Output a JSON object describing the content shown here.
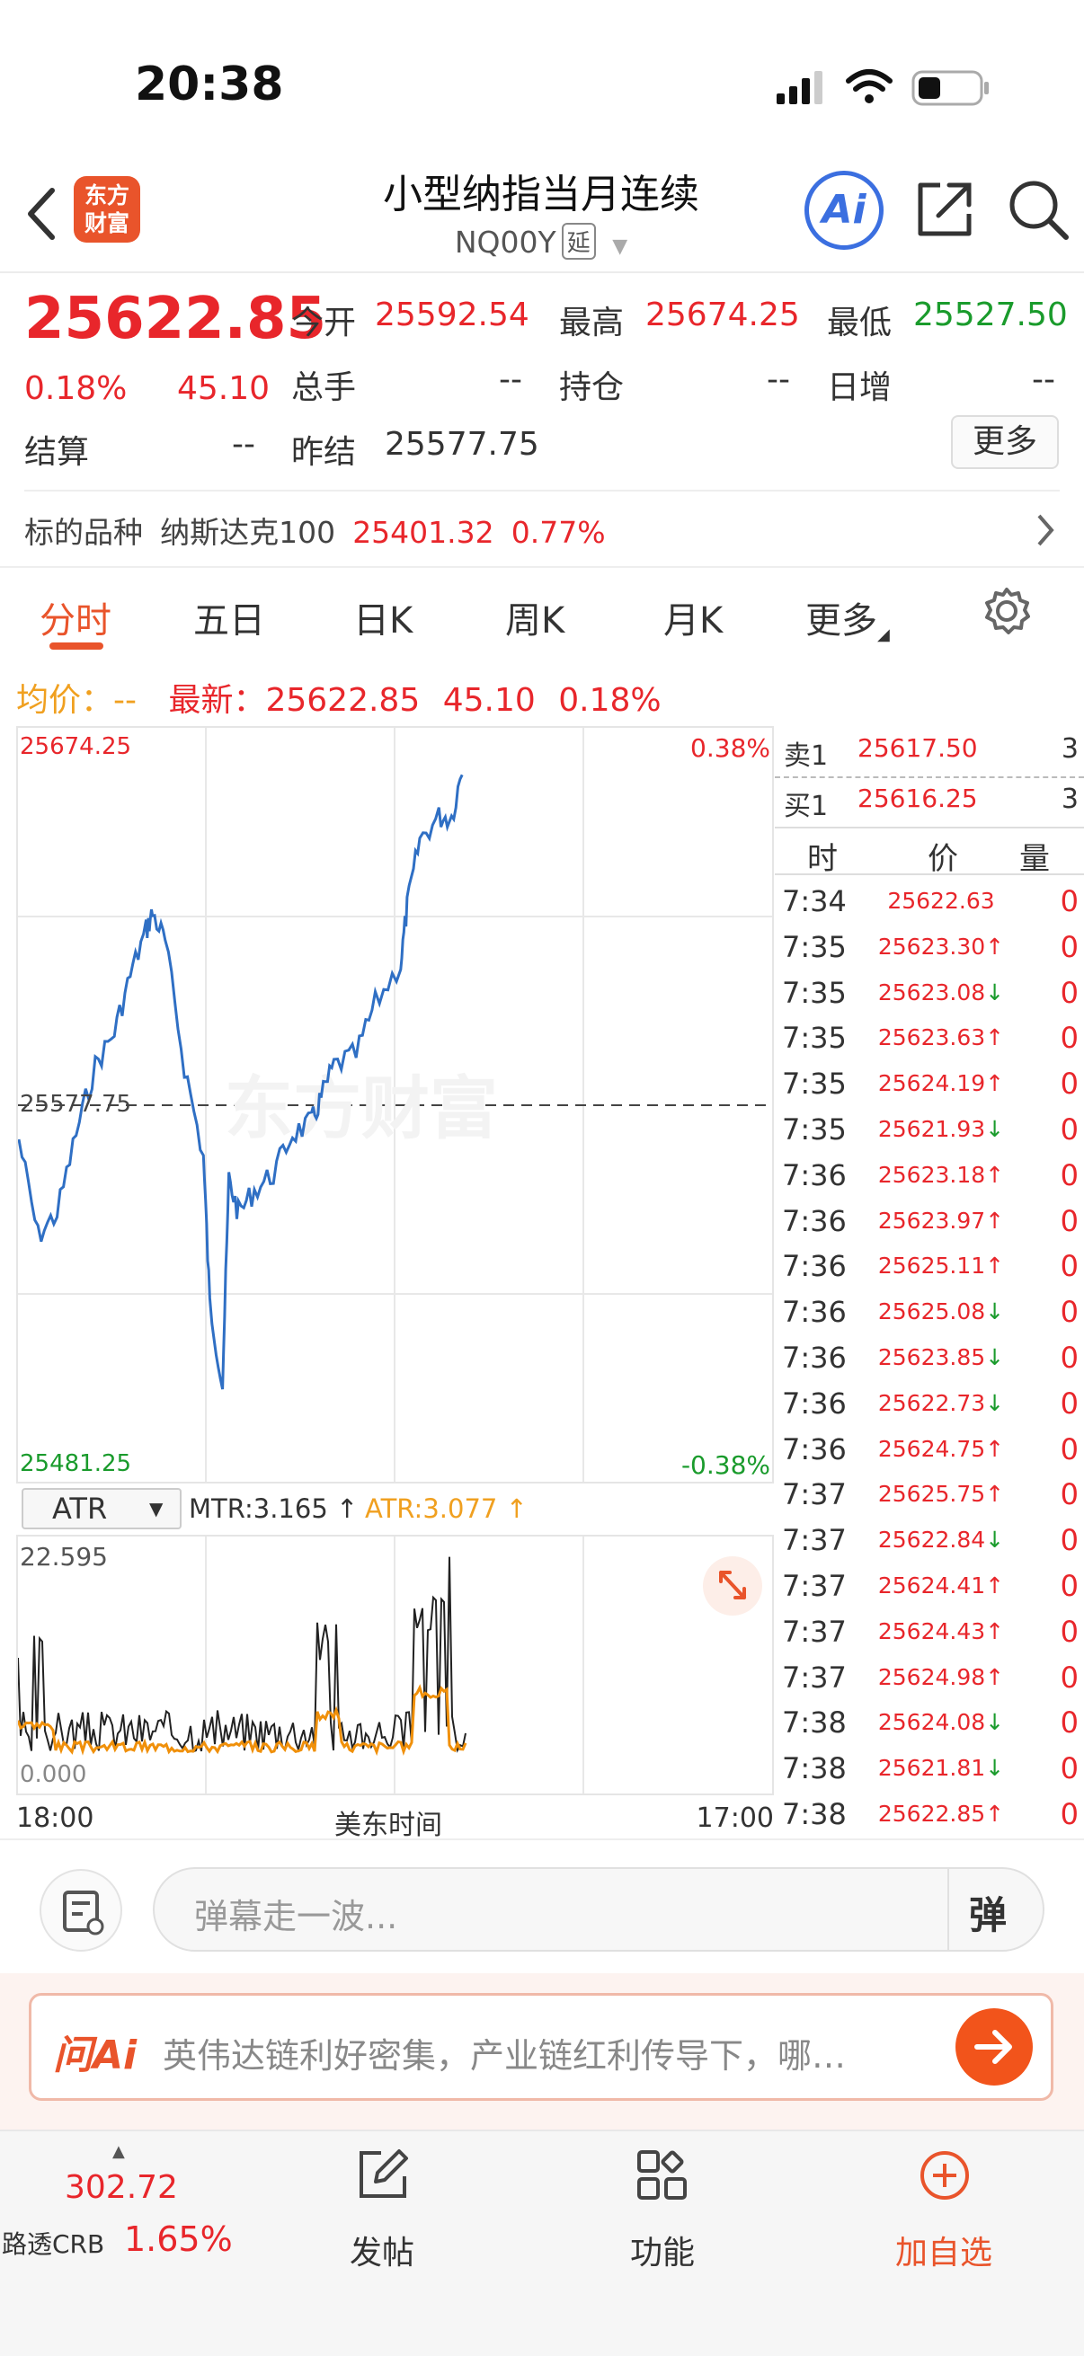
{
  "status": {
    "time": "20:38"
  },
  "nav": {
    "logo_line1": "东方",
    "logo_line2": "财富",
    "title": "小型纳指当月连续",
    "code": "NQ00Y",
    "tag": "延",
    "ai_label": "Ai"
  },
  "quote": {
    "price": "25622.85",
    "change_pct": "0.18%",
    "change": "45.10",
    "open_label": "今开",
    "open": "25592.54",
    "high_label": "最高",
    "high": "25674.25",
    "low_label": "最低",
    "low": "25527.50",
    "volume_label": "总手",
    "volume": "--",
    "position_label": "持仓",
    "position": "--",
    "daily_inc_label": "日增",
    "daily_inc": "--",
    "settle_label": "结算",
    "settle": "--",
    "prev_settle_label": "昨结",
    "prev_settle": "25577.75",
    "more_label": "更多"
  },
  "underlying": {
    "label": "标的品种",
    "name": "纳斯达克100",
    "price": "25401.32",
    "pct": "0.77%"
  },
  "tabs": [
    "分时",
    "五日",
    "日K",
    "周K",
    "月K",
    "更多"
  ],
  "avg": {
    "avg_label": "均价：",
    "avg_value": "--",
    "latest_label": "最新：",
    "latest_value": "25622.85",
    "change": "45.10",
    "pct": "0.18%"
  },
  "chart": {
    "y_top": "25674.25",
    "y_mid": "25577.75",
    "y_bottom": "25481.25",
    "pct_top": "0.38%",
    "pct_bottom": "-0.38%",
    "watermark": "东方财富",
    "x_start": "18:00",
    "x_mid": "美东时间",
    "x_end": "17:00"
  },
  "atr": {
    "select": "ATR",
    "mtr_label": "MTR:3.165 ↑",
    "atr_label": "ATR:3.077 ↑",
    "max_label": "22.595",
    "min_label": "0.000"
  },
  "orderbook": {
    "sell_label": "卖1",
    "sell_price": "25617.50",
    "sell_vol": "3",
    "buy_label": "买1",
    "buy_price": "25616.25",
    "buy_vol": "3",
    "col_time": "时",
    "col_price": "价",
    "col_vol": "量"
  },
  "ticks": [
    {
      "t": "7:34",
      "p": "25622.63",
      "d": "",
      "v": "0"
    },
    {
      "t": "7:35",
      "p": "25623.30",
      "d": "up",
      "v": "0"
    },
    {
      "t": "7:35",
      "p": "25623.08",
      "d": "down",
      "v": "0"
    },
    {
      "t": "7:35",
      "p": "25623.63",
      "d": "up",
      "v": "0"
    },
    {
      "t": "7:35",
      "p": "25624.19",
      "d": "up",
      "v": "0"
    },
    {
      "t": "7:35",
      "p": "25621.93",
      "d": "down",
      "v": "0"
    },
    {
      "t": "7:36",
      "p": "25623.18",
      "d": "up",
      "v": "0"
    },
    {
      "t": "7:36",
      "p": "25623.97",
      "d": "up",
      "v": "0"
    },
    {
      "t": "7:36",
      "p": "25625.11",
      "d": "up",
      "v": "0"
    },
    {
      "t": "7:36",
      "p": "25625.08",
      "d": "down",
      "v": "0"
    },
    {
      "t": "7:36",
      "p": "25623.85",
      "d": "down",
      "v": "0"
    },
    {
      "t": "7:36",
      "p": "25622.73",
      "d": "down",
      "v": "0"
    },
    {
      "t": "7:36",
      "p": "25624.75",
      "d": "up",
      "v": "0"
    },
    {
      "t": "7:37",
      "p": "25625.75",
      "d": "up",
      "v": "0"
    },
    {
      "t": "7:37",
      "p": "25622.84",
      "d": "down",
      "v": "0"
    },
    {
      "t": "7:37",
      "p": "25624.41",
      "d": "up",
      "v": "0"
    },
    {
      "t": "7:37",
      "p": "25624.43",
      "d": "up",
      "v": "0"
    },
    {
      "t": "7:37",
      "p": "25624.98",
      "d": "up",
      "v": "0"
    },
    {
      "t": "7:38",
      "p": "25624.08",
      "d": "down",
      "v": "0"
    },
    {
      "t": "7:38",
      "p": "25621.81",
      "d": "down",
      "v": "0"
    },
    {
      "t": "7:38",
      "p": "25622.85",
      "d": "up",
      "v": "0"
    }
  ],
  "input": {
    "placeholder": "弹幕走一波...",
    "danmu_label": "弹"
  },
  "ai_bar": {
    "label": "问Ai",
    "text": "英伟达链利好密集，产业链红利传导下，哪…"
  },
  "bottom": {
    "crb_value": "302.72",
    "crb_label": "路透CRB",
    "crb_pct": "1.65%",
    "post_label": "发帖",
    "func_label": "功能",
    "add_label": "加自选"
  }
}
